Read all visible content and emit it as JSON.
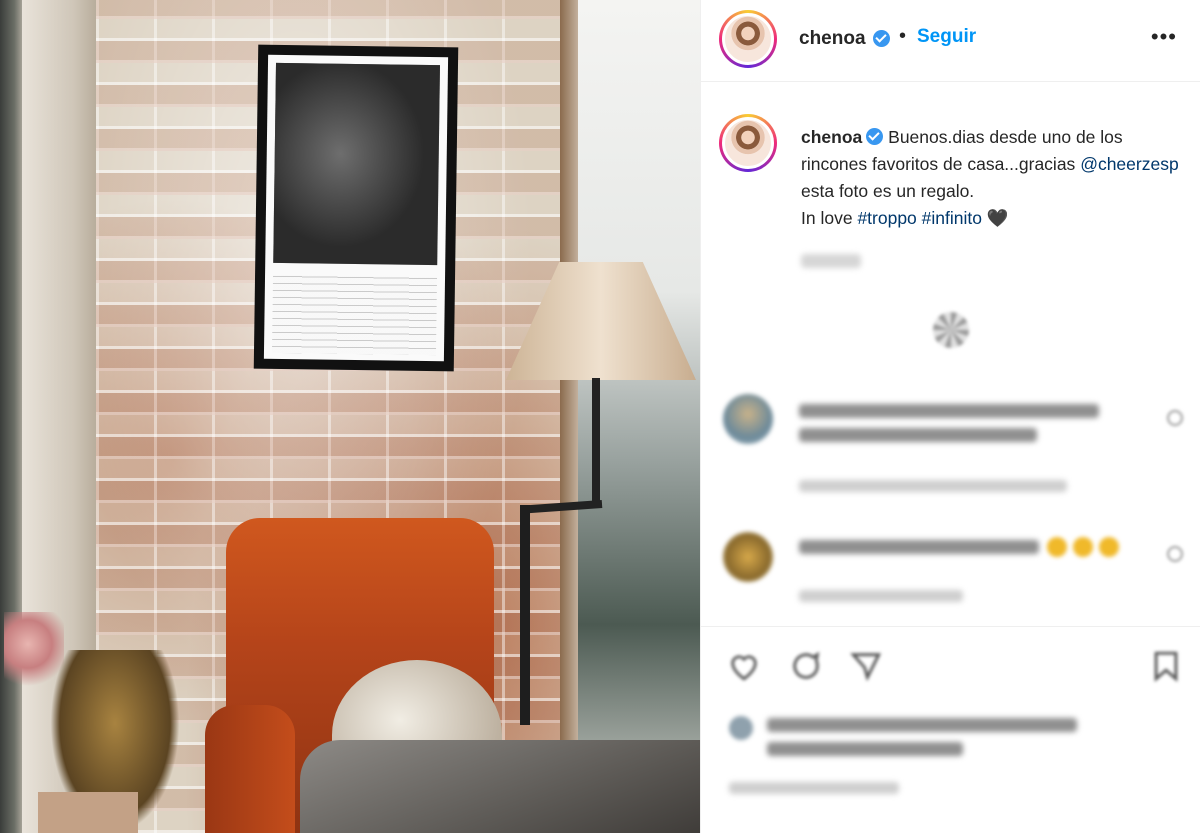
{
  "post": {
    "username": "chenoa",
    "verified_icon": "verified-badge-icon",
    "separator": "•",
    "follow_label": "Seguir",
    "more_label": "•••"
  },
  "caption": {
    "username": "chenoa",
    "text_part1": "Buenos.dias desde uno de los rincones favoritos de casa...gracias",
    "mention": "@cheerzesp",
    "text_part2": "esta foto es un regalo.",
    "text_part3": "In love",
    "hashtag1": "#troppo",
    "hashtag2": "#infinito",
    "heart": "🖤"
  },
  "colors": {
    "accent": "#0095f6",
    "link": "#00376b",
    "text": "#262626",
    "divider": "#efefef"
  },
  "icons": [
    "like-icon",
    "comment-icon",
    "share-icon",
    "save-icon",
    "more-options-icon",
    "loading-spinner-icon"
  ]
}
